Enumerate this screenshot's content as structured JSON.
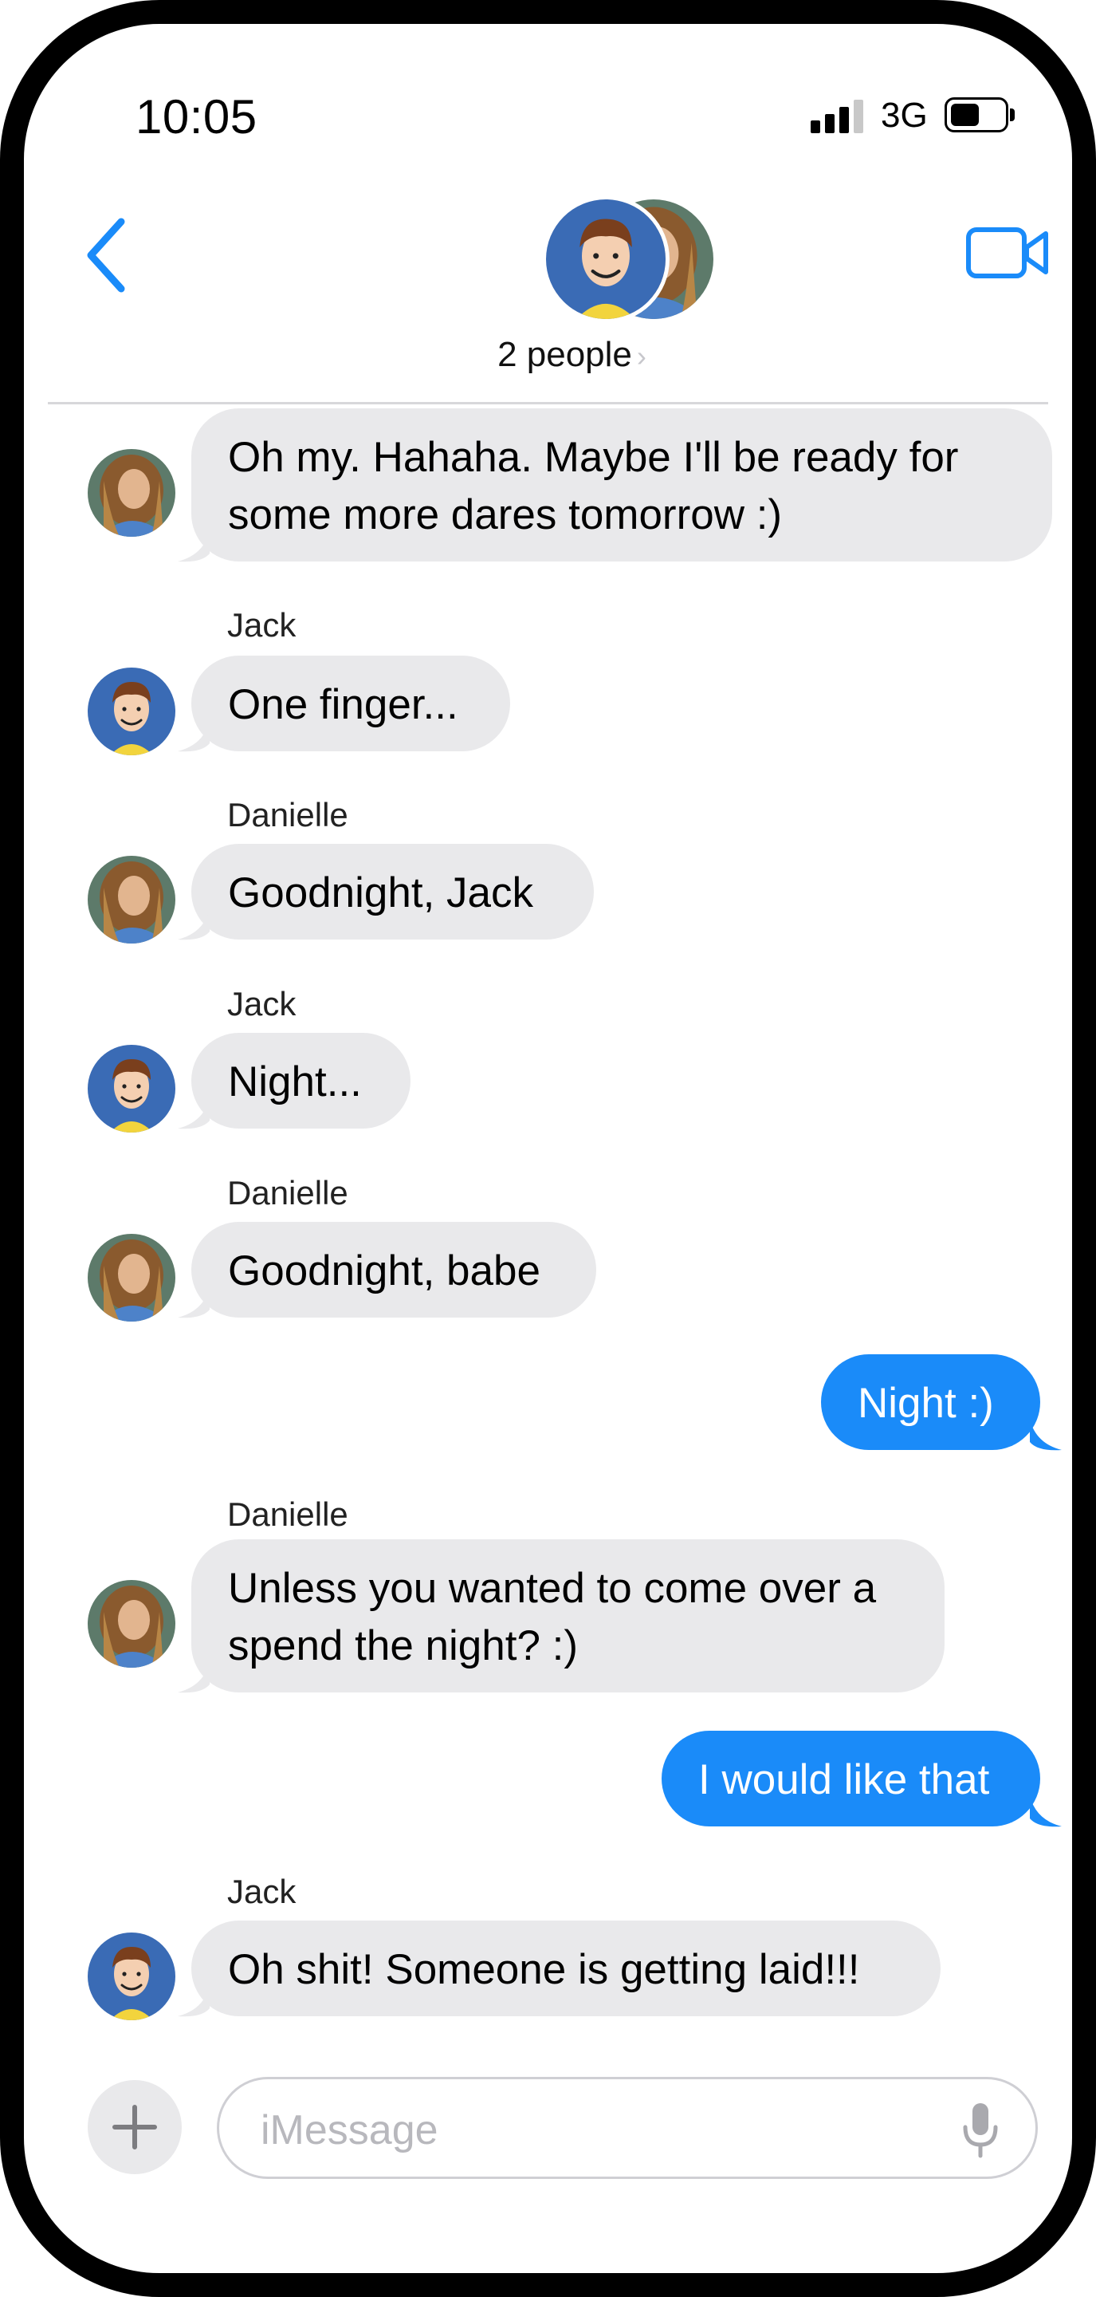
{
  "status_bar": {
    "time": "10:05",
    "network": "3G",
    "battery_level": 0.55
  },
  "header": {
    "people_label": "2 people",
    "people_chevron": "›"
  },
  "messages": [
    {
      "sender": "",
      "text_lines": [
        "Oh my.  Hahaha.  Maybe I'll be ready for",
        "some more dares tomorrow :)"
      ],
      "direction": "incoming",
      "avatar": "danielle-avatar"
    },
    {
      "sender": "Jack",
      "text_lines": [
        "One finger..."
      ],
      "direction": "incoming",
      "avatar": "jack-avatar"
    },
    {
      "sender": "Danielle",
      "text_lines": [
        "Goodnight, Jack"
      ],
      "direction": "incoming",
      "avatar": "danielle-avatar"
    },
    {
      "sender": "Jack",
      "text_lines": [
        "Night..."
      ],
      "direction": "incoming",
      "avatar": "jack-avatar"
    },
    {
      "sender": "Danielle",
      "text_lines": [
        "Goodnight, babe"
      ],
      "direction": "incoming",
      "avatar": "danielle-avatar"
    },
    {
      "sender": "",
      "text_lines": [
        "Night :)"
      ],
      "direction": "outgoing"
    },
    {
      "sender": "Danielle",
      "text_lines": [
        "Unless you wanted to come over a",
        "spend the night? :)"
      ],
      "direction": "incoming",
      "avatar": "danielle-avatar"
    },
    {
      "sender": "",
      "text_lines": [
        "I would like that"
      ],
      "direction": "outgoing"
    },
    {
      "sender": "Jack",
      "text_lines": [
        "Oh shit!  Someone is getting laid!!!"
      ],
      "direction": "incoming",
      "avatar": "jack-avatar"
    }
  ],
  "composer": {
    "placeholder": "iMessage",
    "value": ""
  },
  "icons": {
    "back": "chevron-left-icon",
    "video": "video-camera-icon",
    "plus": "plus-icon",
    "mic": "microphone-icon"
  },
  "colors": {
    "accent": "#1a8bf9",
    "incoming_bubble": "#e9e9eb",
    "jack_avatar_bg": "#3a6bb5"
  }
}
